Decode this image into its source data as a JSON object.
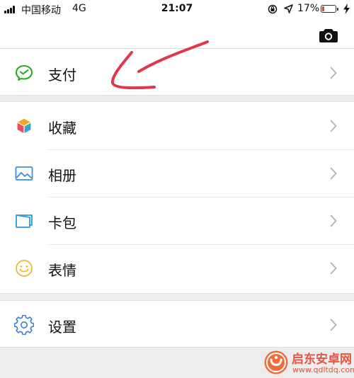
{
  "status_bar": {
    "carrier": "中国移动",
    "network": "4G",
    "time": "21:07",
    "battery_percent": "17%",
    "battery_level": 0.17,
    "icons": [
      "signal-icon",
      "orientation-lock-icon",
      "location-arrow-icon",
      "battery-icon",
      "charging-bolt-icon"
    ]
  },
  "header": {
    "icon": "camera-icon"
  },
  "menu": {
    "pay": {
      "label": "支付",
      "icon": "wechat-pay-icon"
    },
    "favorites": {
      "label": "收藏",
      "icon": "cube-favorites-icon"
    },
    "album": {
      "label": "相册",
      "icon": "photo-album-icon"
    },
    "cards": {
      "label": "卡包",
      "icon": "card-wallet-icon"
    },
    "stickers": {
      "label": "表情",
      "icon": "smiley-icon"
    },
    "settings": {
      "label": "设置",
      "icon": "gear-icon"
    }
  },
  "colors": {
    "pay_green": "#1aad19",
    "favorites_multicolor": [
      "#f5a623",
      "#e94f64",
      "#3d9be9",
      "#2dc38a"
    ],
    "album_blue": "#3d8ee0",
    "cards_blue": "#2f9bd6",
    "stickers_yellow": "#f2b531",
    "settings_blue": "#3b7bd4",
    "annotation_red": "#e0384a"
  },
  "watermark": {
    "title": "启东安卓网",
    "url": "www.qdltdq.com"
  }
}
